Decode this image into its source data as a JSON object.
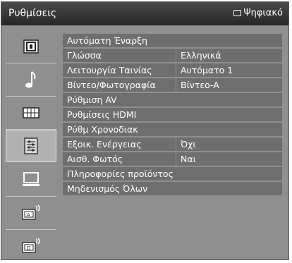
{
  "header": {
    "title": "Ρυθμίσεις",
    "source_label": "Ψηφιακό"
  },
  "sidebar": {
    "items": [
      {
        "name": "picture-icon"
      },
      {
        "name": "music-note-icon"
      },
      {
        "name": "video-grid-icon"
      },
      {
        "name": "settings-list-icon",
        "selected": true
      },
      {
        "name": "monitor-icon"
      },
      {
        "name": "tuning-a-icon",
        "letter": "A"
      },
      {
        "name": "tuning-d-icon",
        "letter": "D"
      }
    ]
  },
  "menu": {
    "rows": [
      {
        "label": "Αυτόματη Έναρξη",
        "value": ""
      },
      {
        "label": "Γλώσσα",
        "value": "Ελληνικά"
      },
      {
        "label": "Λειτουργία Ταινίας",
        "value": "Αυτόματο 1"
      },
      {
        "label": "Βίντεο/Φωτογραφία",
        "value": "Βίντεο-Α"
      },
      {
        "label": "Ρύθμιση AV",
        "value": ""
      },
      {
        "label": "Ρυθμίσεις HDMI",
        "value": ""
      },
      {
        "label": "Ρύθμ Χρονοδιακ",
        "value": ""
      },
      {
        "label": "Εξοικ. Ενέργειας",
        "value": "Όχι"
      },
      {
        "label": "Αισθ. Φωτός",
        "value": "Ναι"
      },
      {
        "label": "Πληροφορίες προϊόντος",
        "value": ""
      },
      {
        "label": "Μηδενισμός Όλων",
        "value": ""
      }
    ]
  }
}
